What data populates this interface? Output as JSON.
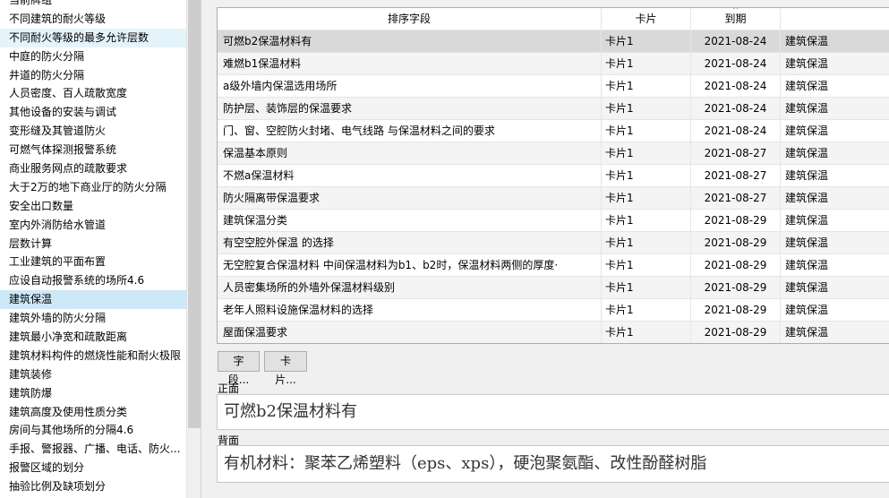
{
  "deck_list": {
    "items": [
      "当前牌组",
      "不同建筑的耐火等级",
      "不同耐火等级的最多允许层数",
      "中庭的防火分隔",
      "井道的防火分隔",
      "人员密度、百人疏散宽度",
      "其他设备的安装与调试",
      "变形缝及其管道防火",
      "可燃气体探测报警系统",
      "商业服务网点的疏散要求",
      "大于2万的地下商业厅的防火分隔",
      "安全出口数量",
      "室内外消防给水管道",
      "层数计算",
      "工业建筑的平面布置",
      "应设自动报警系统的场所4.6",
      "建筑保温",
      "建筑外墙的防火分隔",
      "建筑最小净宽和疏散距离",
      "建筑材料构件的燃烧性能和耐火极限",
      "建筑装修",
      "建筑防爆",
      "建筑高度及使用性质分类",
      "房间与其他场所的分隔4.6",
      "手报、警报器、广播、电话、防火...",
      "报警区域的划分",
      "抽验比例及缺项划分"
    ],
    "selected_index": 16,
    "hover_index": 2
  },
  "table": {
    "headers": {
      "sort_field": "排序字段",
      "card": "卡片",
      "due": "到期",
      "deck": ""
    },
    "sort_indicator": "^",
    "rows": [
      {
        "sort_field": "可燃b2保温材料有",
        "card": "卡片1",
        "due": "2021-08-24",
        "deck": "建筑保温"
      },
      {
        "sort_field": "难燃b1保温材料",
        "card": "卡片1",
        "due": "2021-08-24",
        "deck": "建筑保温"
      },
      {
        "sort_field": "a级外墙内保温选用场所",
        "card": "卡片1",
        "due": "2021-08-24",
        "deck": "建筑保温"
      },
      {
        "sort_field": "防护层、装饰层的保温要求",
        "card": "卡片1",
        "due": "2021-08-24",
        "deck": "建筑保温"
      },
      {
        "sort_field": "门、窗、空腔防火封堵、电气线路 与保温材料之间的要求",
        "card": "卡片1",
        "due": "2021-08-24",
        "deck": "建筑保温"
      },
      {
        "sort_field": "保温基本原则",
        "card": "卡片1",
        "due": "2021-08-27",
        "deck": "建筑保温"
      },
      {
        "sort_field": "不燃a保温材料",
        "card": "卡片1",
        "due": "2021-08-27",
        "deck": "建筑保温"
      },
      {
        "sort_field": "防火隔离带保温要求",
        "card": "卡片1",
        "due": "2021-08-27",
        "deck": "建筑保温"
      },
      {
        "sort_field": "建筑保温分类",
        "card": "卡片1",
        "due": "2021-08-29",
        "deck": "建筑保温"
      },
      {
        "sort_field": "有空空腔外保温 的选择",
        "card": "卡片1",
        "due": "2021-08-29",
        "deck": "建筑保温"
      },
      {
        "sort_field": "无空腔复合保温材料 中间保温材料为b1、b2时，保温材料两侧的厚度·",
        "card": "卡片1",
        "due": "2021-08-29",
        "deck": "建筑保温"
      },
      {
        "sort_field": "人员密集场所的外墙外保温材料级别",
        "card": "卡片1",
        "due": "2021-08-29",
        "deck": "建筑保温"
      },
      {
        "sort_field": "老年人照料设施保温材料的选择",
        "card": "卡片1",
        "due": "2021-08-29",
        "deck": "建筑保温"
      },
      {
        "sort_field": "屋面保温要求",
        "card": "卡片1",
        "due": "2021-08-29",
        "deck": "建筑保温"
      }
    ],
    "selected_index": 0
  },
  "buttons": {
    "fields_label": "字段...",
    "cards_label": "卡片..."
  },
  "editor": {
    "front_label": "正面",
    "front_value": "可燃b2保温材料有",
    "back_label": "背面",
    "back_value": "有机材料：聚苯乙烯塑料（eps、xps），硬泡聚氨酯、改性酚醛树脂"
  },
  "colors": {
    "selected_deck": "#cde8f7",
    "selected_row": "#d9d9d9",
    "alt_row": "#f4f4f4"
  }
}
